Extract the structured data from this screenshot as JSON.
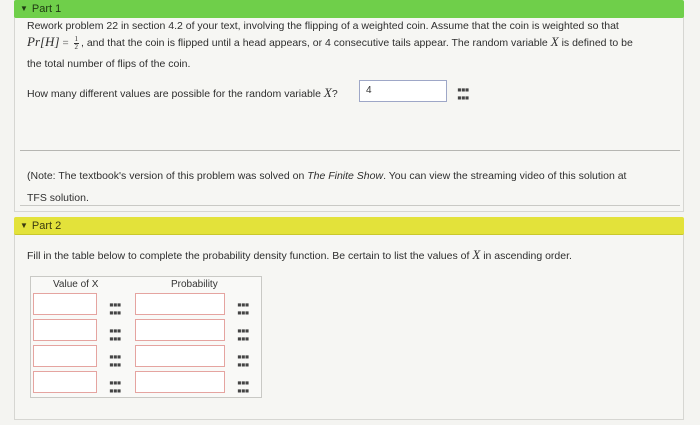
{
  "part1": {
    "label": "Part 1",
    "problem_line1": "Rework problem 22 in section 4.2 of your text, involving the flipping of a weighted coin. Assume that the coin is weighted so that",
    "problem_math_pr": "Pr[H]",
    "problem_eq": "=",
    "problem_frac_num": "1",
    "problem_frac_den": "2",
    "problem_line2_tail": ", and that the coin is flipped until a head appears, or 4 consecutive tails appear. The random variable",
    "problem_math_x": "X",
    "problem_line2_end": "is defined to be",
    "problem_line3": "the total number of flips of the coin.",
    "question_pre": "How many different values are possible for the random variable",
    "question_math_x": "X",
    "question_post": "?",
    "answer_value": "4",
    "note_line1_a": "(Note: The textbook's version of this problem was solved on",
    "note_line1_italic": "The Finite Show",
    "note_line1_b": ". You can view the streaming video of this solution at",
    "note_line2": "TFS solution."
  },
  "part2": {
    "label": "Part 2",
    "instruction_pre": "Fill in the table below to complete the probability density function. Be certain to list the values of",
    "instruction_math_x": "X",
    "instruction_post": "in ascending order.",
    "col_value": "Value of X",
    "col_probability": "Probability",
    "rows": [
      {
        "value": "",
        "probability": ""
      },
      {
        "value": "",
        "probability": ""
      },
      {
        "value": "",
        "probability": ""
      },
      {
        "value": "",
        "probability": ""
      }
    ]
  },
  "icons": {
    "matrix": "matrix-grid-icon",
    "caret": "caret-down-icon"
  },
  "colors": {
    "part1_header": "#6fcf4a",
    "part2_header": "#e3e23a",
    "input_border_error": "#e5a4a0",
    "answer_border": "#9ea7c7"
  }
}
